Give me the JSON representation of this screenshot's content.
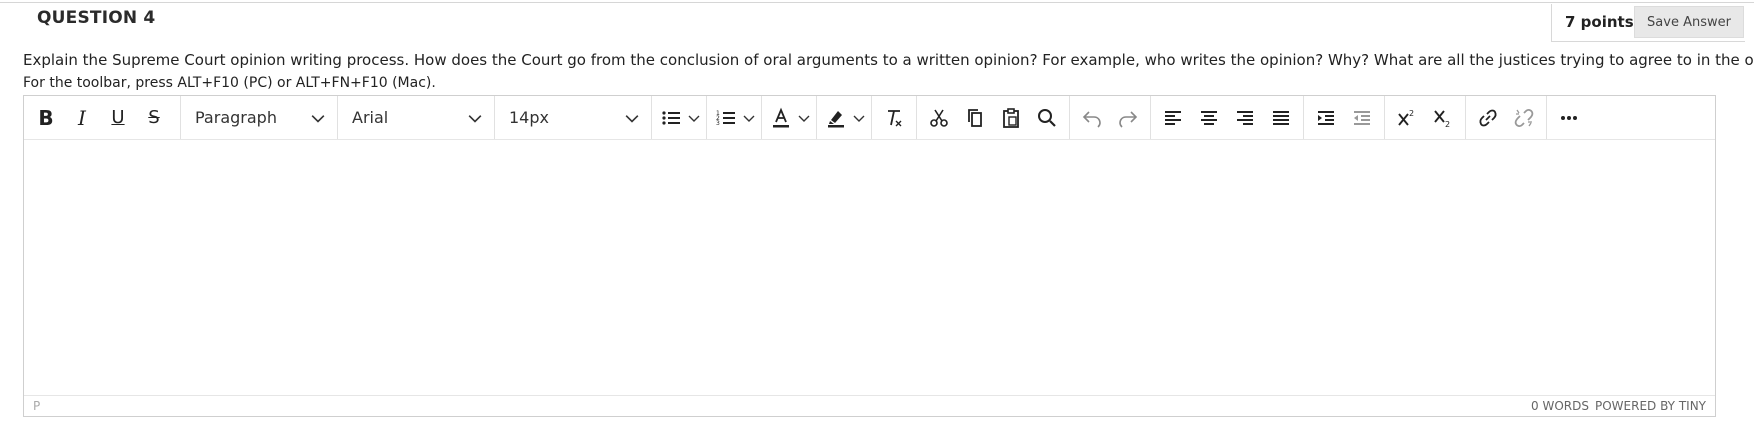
{
  "question": {
    "title": "QUESTION 4",
    "points": "7 points",
    "save_label": "Save Answer",
    "prompt": "Explain the Supreme Court opinion writing process. How does the Court go from the conclusion of oral arguments to a written opinion? For example, who writes the opinion? Why? What are all the justices trying to agree to in the opinion?",
    "toolbar_hint": "For the toolbar, press ALT+F10 (PC) or ALT+FN+F10 (Mac)."
  },
  "editor": {
    "format_select": "Paragraph",
    "font_select": "Arial",
    "size_select": "14px",
    "text_formatting": {
      "bold": "B",
      "italic": "I",
      "underline": "U",
      "strikethrough": "S"
    },
    "icons": [
      "bullet-list-icon",
      "numbered-list-icon",
      "text-color-icon",
      "highlight-icon",
      "clear-formatting-icon",
      "cut-icon",
      "copy-icon",
      "paste-icon",
      "search-icon",
      "undo-icon",
      "redo-icon",
      "align-left-icon",
      "align-center-icon",
      "align-right-icon",
      "justify-icon",
      "indent-icon",
      "outdent-icon",
      "superscript-icon",
      "subscript-icon",
      "link-icon",
      "unlink-icon",
      "more-icon"
    ],
    "status_path": "P",
    "word_count": "0 WORDS",
    "powered_by": "POWERED BY TINY"
  }
}
